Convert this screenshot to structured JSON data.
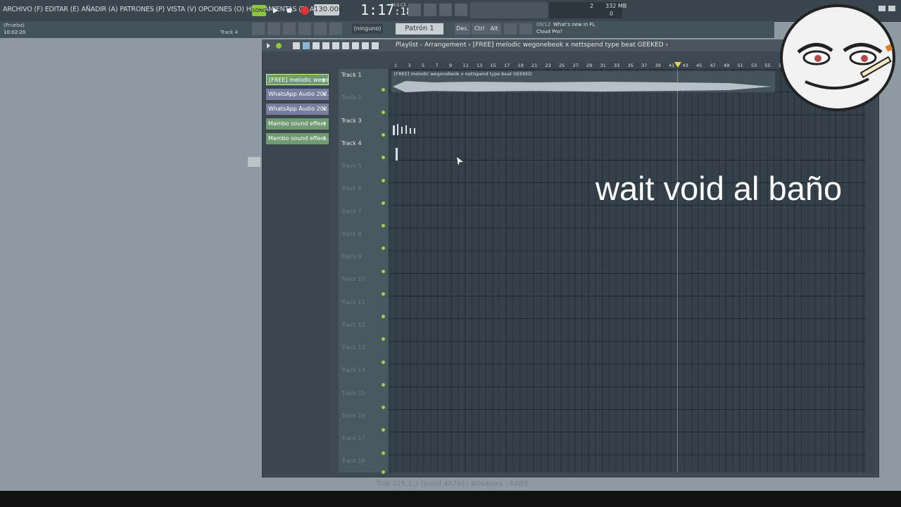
{
  "menu": [
    "ARCHIVO (F)",
    "EDITAR (E)",
    "AÑADIR (A)",
    "PATRONES (P)",
    "VISTA (V)",
    "OPCIONES (O)",
    "HERRAMIENTAS (T)",
    "AYUDA"
  ],
  "transport": {
    "song_label": "SONG",
    "tempo": "130.000",
    "time_main": "1:17",
    "time_frac": ":18",
    "time_sub": "M:S:CS"
  },
  "monitor": {
    "cpu": "2",
    "memory": "332 MB",
    "poly": "0"
  },
  "hint": {
    "title": "(Prueba)",
    "time": "10:02:20",
    "track": "Track 4"
  },
  "toolbar2": {
    "pattern_none": "(ninguno)",
    "pattern_selected": "Patrón 1",
    "btn_des": "Des.",
    "btn_ctrl": "Ctrl",
    "btn_alt": "Alt",
    "news_date": "09/12",
    "news_title": "What's new in FL",
    "news_sub": "Cloud Pro?"
  },
  "playlist": {
    "title": "Playlist - Arrangement › [FREE] melodic wegonebeok x nettspend type beat GEEKED ›",
    "patterns": [
      {
        "label": "[FREE] melodic wego...",
        "kind": "green"
      },
      {
        "label": "WhatsApp Audio 202...",
        "kind": "purple"
      },
      {
        "label": "WhatsApp Audio 202...",
        "kind": "purple"
      },
      {
        "label": "Mambo sound effect",
        "kind": "green"
      },
      {
        "label": "Mambo sound effect...",
        "kind": "green"
      }
    ],
    "tracks": [
      "Track 1",
      "Track 2",
      "Track 3",
      "Track 4",
      "Track 5",
      "Track 6",
      "Track 7",
      "Track 8",
      "Track 9",
      "Track 10",
      "Track 11",
      "Track 12",
      "Track 13",
      "Track 14",
      "Track 15",
      "Track 16",
      "Track 17",
      "Track 18"
    ],
    "ruler": [
      "1",
      "3",
      "5",
      "7",
      "9",
      "11",
      "13",
      "15",
      "17",
      "19",
      "21",
      "23",
      "25",
      "27",
      "29",
      "31",
      "33",
      "35",
      "37",
      "39",
      "41",
      "43",
      "45",
      "47",
      "49",
      "51",
      "53",
      "55",
      "57"
    ],
    "clip1_name": "[FREE] melodic wegonebeok x nettspend type beat GEEKED"
  },
  "status": "Trial v25.1.1 [build 4879] - Windows - 64Bit",
  "overlay": {
    "caption": "wait void al baño"
  },
  "colors": {
    "accent_green": "#9ed04a",
    "pattern_green": "#6f9a72",
    "pattern_purple": "#777f9e"
  }
}
